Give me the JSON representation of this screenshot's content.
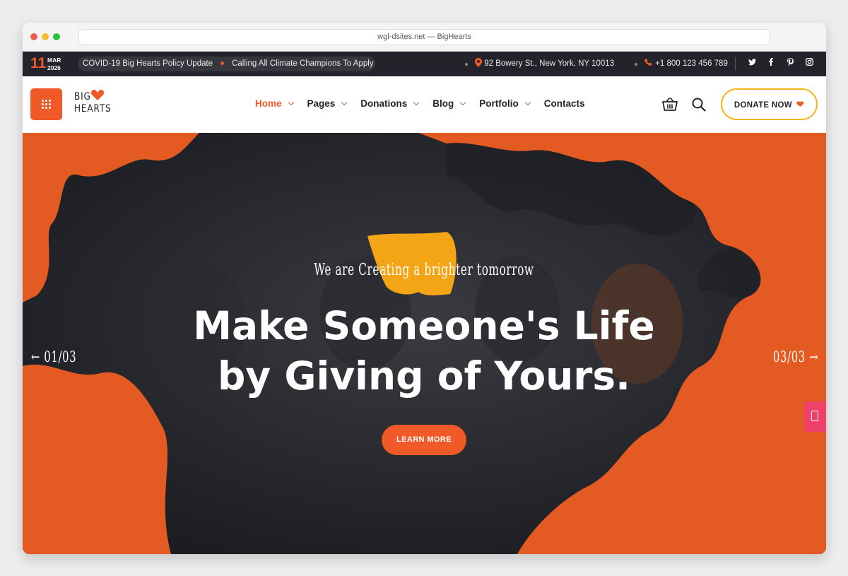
{
  "browser": {
    "address": "wgl-dsites.net — BigHearts"
  },
  "topbar": {
    "date_day": "11",
    "date_month": "MAR",
    "date_year": "2026",
    "news": [
      "COVID-19 Big Hearts Policy Update",
      "Calling All Climate Champions To Apply"
    ],
    "address": "92 Bowery St., New York, NY 10013",
    "phone": "+1 800 123 456 789",
    "social_icons": [
      "twitter-icon",
      "facebook-icon",
      "pinterest-icon",
      "instagram-icon"
    ]
  },
  "navbar": {
    "logo_line1": "BIG",
    "logo_line2": "HEARTS",
    "menu": [
      {
        "label": "Home",
        "active": true,
        "dropdown": true
      },
      {
        "label": "Pages",
        "active": false,
        "dropdown": true
      },
      {
        "label": "Donations",
        "active": false,
        "dropdown": true
      },
      {
        "label": "Blog",
        "active": false,
        "dropdown": true
      },
      {
        "label": "Portfolio",
        "active": false,
        "dropdown": true
      },
      {
        "label": "Contacts",
        "active": false,
        "dropdown": false
      }
    ],
    "donate_label": "DONATE NOW"
  },
  "hero": {
    "tagline": "We are Creating a brighter tomorrow",
    "headline_line1": "Make Someone's Life",
    "headline_line2": "by Giving of Yours.",
    "button_label": "LEARN MORE",
    "prev_label": "01/03",
    "next_label": "03/03"
  },
  "colors": {
    "accent": "#f05a28",
    "dark": "#22232b",
    "gold": "#f4b41a",
    "pink": "#f0416b"
  }
}
